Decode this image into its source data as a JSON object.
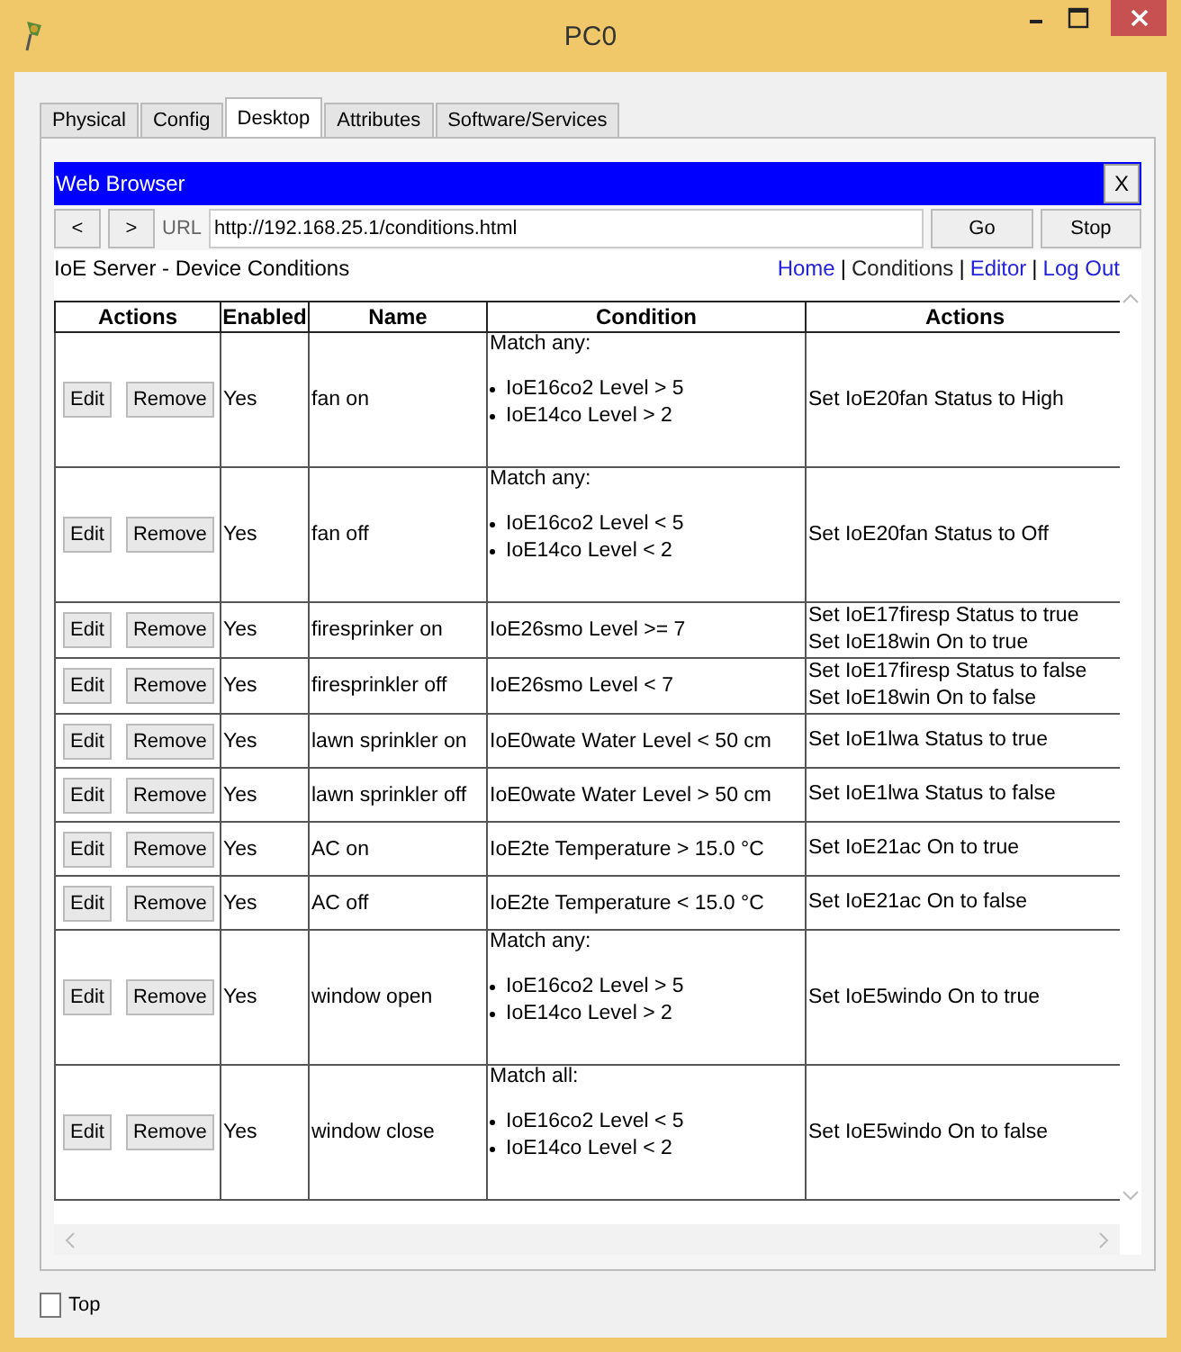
{
  "window": {
    "title": "PC0"
  },
  "tabs": [
    {
      "label": "Physical",
      "selected": false
    },
    {
      "label": "Config",
      "selected": false
    },
    {
      "label": "Desktop",
      "selected": true
    },
    {
      "label": "Attributes",
      "selected": false
    },
    {
      "label": "Software/Services",
      "selected": false
    }
  ],
  "browser": {
    "title": "Web Browser",
    "close": "X",
    "back": "<",
    "forward": ">",
    "url_label": "URL",
    "url": "http://192.168.25.1/conditions.html",
    "go": "Go",
    "stop": "Stop"
  },
  "page": {
    "heading": "IoE Server - Device Conditions",
    "nav_separator": "|",
    "nav": [
      {
        "label": "Home",
        "selected": false
      },
      {
        "label": "Conditions",
        "selected": true
      },
      {
        "label": "Editor",
        "selected": false
      },
      {
        "label": "Log Out",
        "selected": false
      }
    ],
    "table": {
      "columns": [
        "Actions",
        "Enabled",
        "Name",
        "Condition",
        "Actions"
      ],
      "rows": [
        {
          "edit": "Edit",
          "remove": "Remove",
          "enabled": "Yes",
          "name": "fan on",
          "condition": {
            "kind": "list",
            "match": "Match any:",
            "items": [
              "IoE16co2 Level > 5",
              "IoE14co Level > 2"
            ]
          },
          "actions": [
            "Set IoE20fan Status to High"
          ]
        },
        {
          "edit": "Edit",
          "remove": "Remove",
          "enabled": "Yes",
          "name": "fan off",
          "condition": {
            "kind": "list",
            "match": "Match any:",
            "items": [
              "IoE16co2 Level < 5",
              "IoE14co Level < 2"
            ]
          },
          "actions": [
            "Set IoE20fan Status to Off"
          ]
        },
        {
          "edit": "Edit",
          "remove": "Remove",
          "enabled": "Yes",
          "name": "firesprinker on",
          "condition": {
            "kind": "single",
            "text": "IoE26smo Level >= 7"
          },
          "actions": [
            "Set IoE17firesp Status to true",
            "Set IoE18win On to true"
          ]
        },
        {
          "edit": "Edit",
          "remove": "Remove",
          "enabled": "Yes",
          "name": "firesprinkler off",
          "condition": {
            "kind": "single",
            "text": "IoE26smo Level < 7"
          },
          "actions": [
            "Set IoE17firesp Status to false",
            "Set IoE18win On to false"
          ]
        },
        {
          "edit": "Edit",
          "remove": "Remove",
          "enabled": "Yes",
          "name": "lawn sprinkler on",
          "condition": {
            "kind": "single",
            "text": "IoE0wate Water Level < 50 cm"
          },
          "actions": [
            "Set IoE1lwa Status to true"
          ]
        },
        {
          "edit": "Edit",
          "remove": "Remove",
          "enabled": "Yes",
          "name": "lawn sprinkler off",
          "condition": {
            "kind": "single",
            "text": "IoE0wate Water Level > 50 cm"
          },
          "actions": [
            "Set IoE1lwa Status to false"
          ]
        },
        {
          "edit": "Edit",
          "remove": "Remove",
          "enabled": "Yes",
          "name": "AC on",
          "condition": {
            "kind": "single",
            "text": "IoE2te Temperature > 15.0 °C"
          },
          "actions": [
            "Set IoE21ac On to true"
          ]
        },
        {
          "edit": "Edit",
          "remove": "Remove",
          "enabled": "Yes",
          "name": "AC off",
          "condition": {
            "kind": "single",
            "text": "IoE2te Temperature < 15.0 °C"
          },
          "actions": [
            "Set IoE21ac On to false"
          ]
        },
        {
          "edit": "Edit",
          "remove": "Remove",
          "enabled": "Yes",
          "name": "window open",
          "condition": {
            "kind": "list",
            "match": "Match any:",
            "items": [
              "IoE16co2 Level > 5",
              "IoE14co Level > 2"
            ]
          },
          "actions": [
            "Set IoE5windo On to true"
          ]
        },
        {
          "edit": "Edit",
          "remove": "Remove",
          "enabled": "Yes",
          "name": "window close",
          "condition": {
            "kind": "list",
            "match": "Match all:",
            "items": [
              "IoE16co2 Level < 5",
              "IoE14co Level < 2"
            ]
          },
          "actions": [
            "Set IoE5windo On to false"
          ]
        }
      ]
    }
  },
  "footer": {
    "label": "Top",
    "checked": false
  }
}
